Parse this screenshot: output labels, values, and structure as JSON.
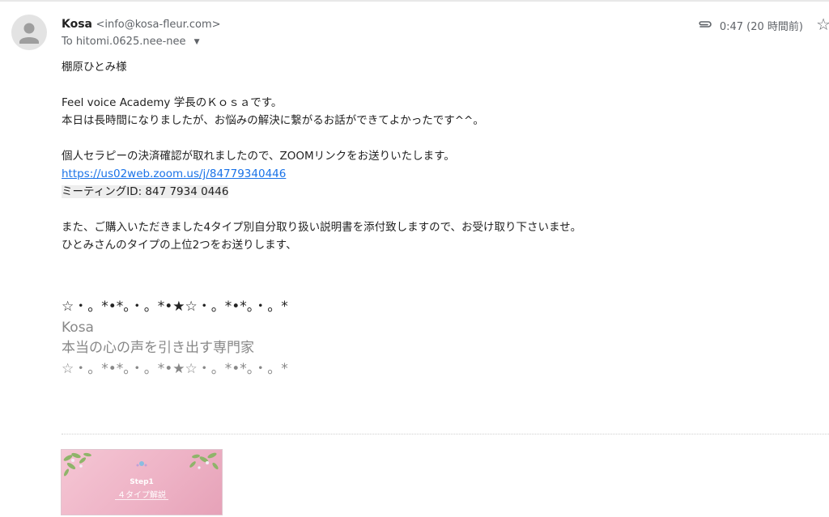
{
  "header": {
    "sender_name": "Kosa",
    "sender_email": "<info@kosa-fleur.com>",
    "recipient": "To hitomi.0625.nee-nee",
    "time": "0:47 (20 時間前)"
  },
  "icons": {
    "avatar": "person-avatar-icon",
    "attachment": "paperclip-icon",
    "recipient_toggle": "caret-down-icon",
    "star": "star-outline-icon"
  },
  "body": {
    "greeting": "棚原ひとみ様",
    "line1": "Feel voice Academy 学長のＫｏｓａです。",
    "line2": "本日は長時間になりましたが、お悩みの解決に繋がるお話ができてよかったです^^。",
    "line3": "個人セラピーの決済確認が取れましたので、ZOOMリンクをお送りいたします。",
    "zoom_link": "https://us02web.zoom.us/j/84779340446",
    "meeting_id": "ミーティングID: 847 7934 0446",
    "line4": "また、ご購入いただきました4タイプ別自分取り扱い説明書を添付致しますので、お受け取り下さいませ。",
    "line5": "ひとみさんのタイプの上位2つをお送りします、"
  },
  "signature": {
    "deco_top": "☆・。*•*。・。*•★☆・。*•*。・。*",
    "name": "Kosa",
    "title": "本当の心の声を引き出す専門家",
    "deco_bottom": "☆・。*•*。・。*•★☆・。*•*。・。*"
  },
  "attachment": {
    "label_line1": "Step1",
    "label_line2": "４タイプ解説"
  },
  "colors": {
    "link": "#1a73e8",
    "muted": "#5f6368",
    "signature_grey": "#888888",
    "attachment_pink": "#eeb3c6"
  }
}
